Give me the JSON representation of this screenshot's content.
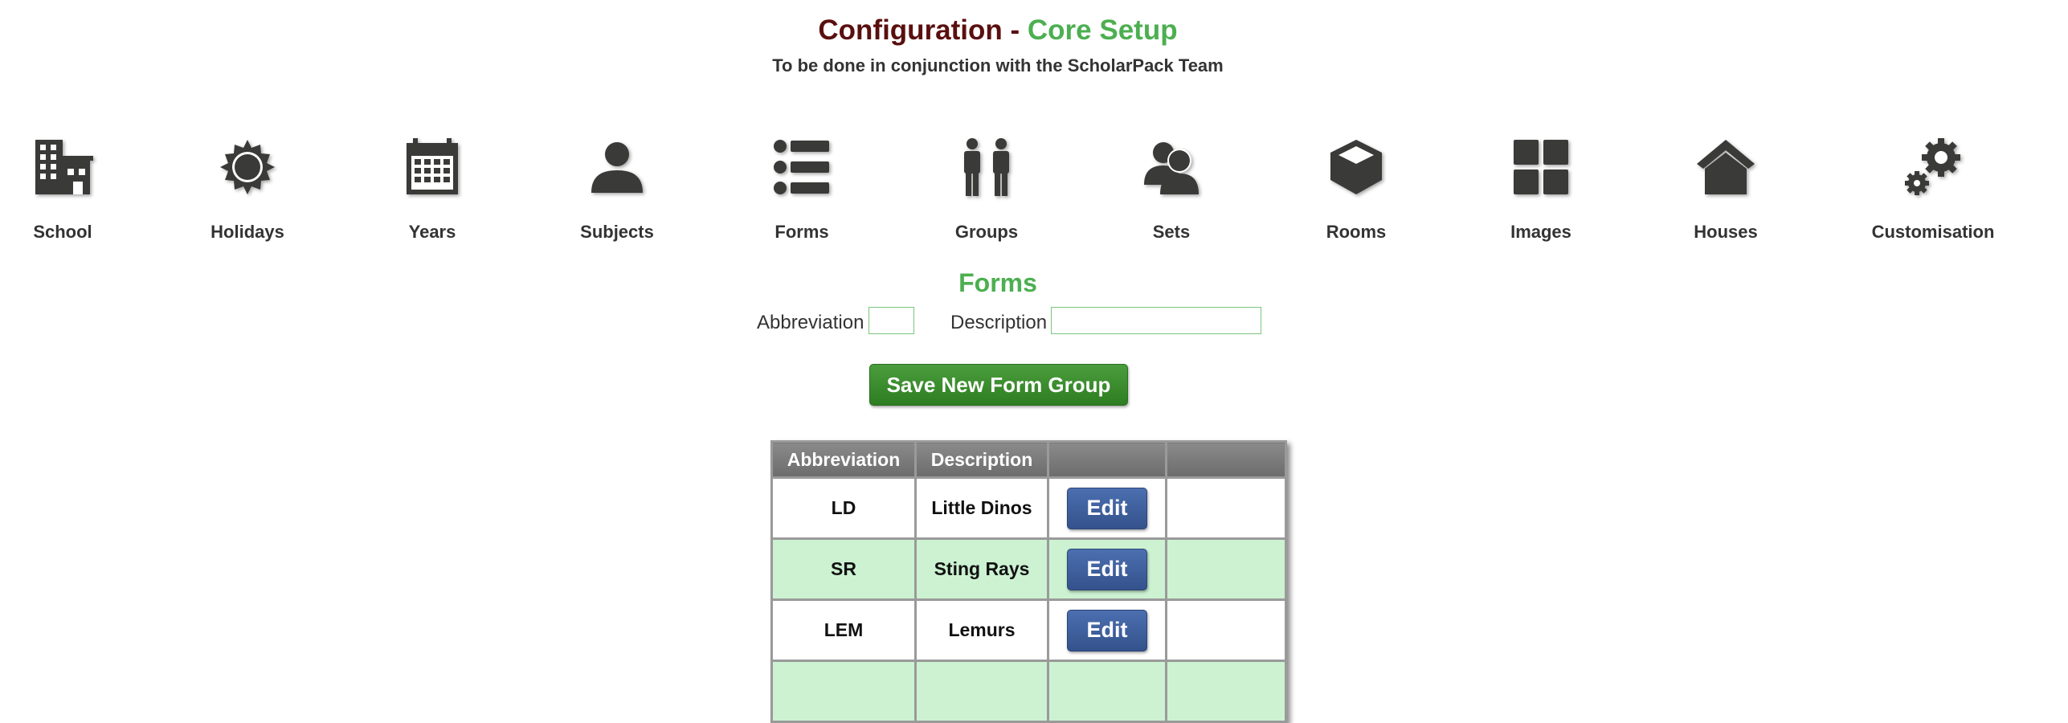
{
  "header": {
    "title_part1": "Configuration - ",
    "title_part2": "Core Setup",
    "subtitle": "To be done in conjunction with the ScholarPack Team"
  },
  "nav": {
    "items": [
      {
        "label": "School",
        "icon": "school-building-icon"
      },
      {
        "label": "Holidays",
        "icon": "sun-icon"
      },
      {
        "label": "Years",
        "icon": "calendar-icon"
      },
      {
        "label": "Subjects",
        "icon": "person-icon"
      },
      {
        "label": "Forms",
        "icon": "list-icon"
      },
      {
        "label": "Groups",
        "icon": "group-people-icon"
      },
      {
        "label": "Sets",
        "icon": "users-icon"
      },
      {
        "label": "Rooms",
        "icon": "cube-icon"
      },
      {
        "label": "Images",
        "icon": "grid-icon"
      },
      {
        "label": "Houses",
        "icon": "house-icon"
      },
      {
        "label": "Customisation",
        "icon": "gears-icon"
      }
    ]
  },
  "section": {
    "title": "Forms"
  },
  "form": {
    "abbreviation_label": "Abbreviation",
    "abbreviation_value": "",
    "description_label": "Description",
    "description_value": "",
    "save_label": "Save New Form Group"
  },
  "table": {
    "headers": [
      "Abbreviation",
      "Description",
      "",
      ""
    ],
    "rows": [
      {
        "abbreviation": "LD",
        "description": "Little Dinos",
        "edit_label": "Edit"
      },
      {
        "abbreviation": "SR",
        "description": "Sting Rays",
        "edit_label": "Edit"
      },
      {
        "abbreviation": "LEM",
        "description": "Lemurs",
        "edit_label": "Edit"
      }
    ]
  },
  "colors": {
    "title_dark": "#5a0f0f",
    "accent_green": "#4caf50",
    "save_button": "#2e7d22",
    "edit_button": "#3a5a9a",
    "row_alt": "#ccf2d2",
    "icon": "#3a3a38"
  }
}
